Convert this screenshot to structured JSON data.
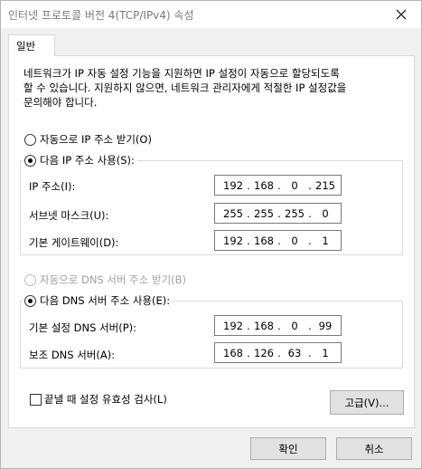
{
  "window": {
    "title": "인터넷 프로토콜 버전 4(TCP/IPv4) 속성"
  },
  "tabs": [
    {
      "label": "일반"
    }
  ],
  "description": "네트워크가 IP 자동 설정 기능을 지원하면 IP 설정이 자동으로 할당되도록\n할 수 있습니다. 지원하지 않으면, 네트워크 관리자에게 적절한 IP 설정값을\n문의해야 합니다.",
  "ip": {
    "auto_label": "자동으로 IP 주소 받기(O)",
    "manual_label": "다음 IP 주소 사용(S):",
    "address_label": "IP 주소(I):",
    "address": [
      "192",
      "168",
      "0",
      "215"
    ],
    "subnet_label": "서브넷 마스크(U):",
    "subnet": [
      "255",
      "255",
      "255",
      "0"
    ],
    "gateway_label": "기본 게이트웨이(D):",
    "gateway": [
      "192",
      "168",
      "0",
      "1"
    ]
  },
  "dns": {
    "auto_label": "자동으로 DNS 서버 주소 받기(B)",
    "manual_label": "다음 DNS 서버 주소 사용(E):",
    "preferred_label": "기본 설정 DNS 서버(P):",
    "preferred": [
      "192",
      "168",
      "0",
      "99"
    ],
    "alternate_label": "보조 DNS 서버(A):",
    "alternate": [
      "168",
      "126",
      "63",
      "1"
    ]
  },
  "validate_label": "끝낼 때 설정 유효성 검사(L)",
  "buttons": {
    "advanced": "고급(V)...",
    "ok": "확인",
    "cancel": "취소"
  }
}
